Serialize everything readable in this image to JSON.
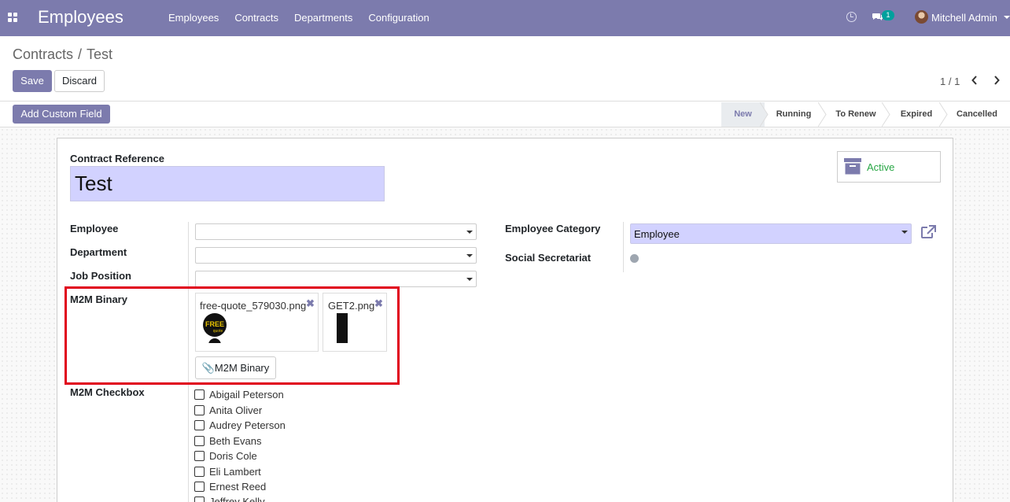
{
  "navbar": {
    "app_title": "Employees",
    "menu": [
      "Employees",
      "Contracts",
      "Departments",
      "Configuration"
    ],
    "messages_count": "1",
    "user_name": "Mitchell Admin",
    "color": "#7c7bad"
  },
  "breadcrumb": {
    "parent": "Contracts",
    "separator": "/",
    "current": "Test"
  },
  "buttons": {
    "save": "Save",
    "discard": "Discard",
    "add_custom_field": "Add Custom Field"
  },
  "pager": {
    "text": "1 / 1"
  },
  "stages": [
    {
      "label": "New",
      "current": true
    },
    {
      "label": "Running",
      "current": false
    },
    {
      "label": "To Renew",
      "current": false
    },
    {
      "label": "Expired",
      "current": false
    },
    {
      "label": "Cancelled",
      "current": false
    }
  ],
  "form": {
    "contract_reference_label": "Contract Reference",
    "contract_reference_value": "Test",
    "active_label": "Active",
    "employee_label": "Employee",
    "employee_value": "",
    "department_label": "Department",
    "department_value": "",
    "job_position_label": "Job Position",
    "job_position_value": "",
    "employee_category_label": "Employee Category",
    "employee_category_value": "Employee",
    "social_secretariat_label": "Social Secretariat",
    "m2m_binary_label": "M2M Binary",
    "m2m_binary_files": [
      "free-quote_579030.png",
      "GET2.png"
    ],
    "m2m_binary_button": "M2M Binary",
    "m2m_checkbox_label": "M2M Checkbox",
    "m2m_checkbox_items": [
      "Abigail Peterson",
      "Anita Oliver",
      "Audrey Peterson",
      "Beth Evans",
      "Doris Cole",
      "Eli Lambert",
      "Ernest Reed",
      "Jeffrey Kelly"
    ]
  },
  "thumbnails": {
    "free_quote_text_1": "FREE",
    "free_quote_text_2": "quote"
  },
  "colors": {
    "accent": "#7c7bad",
    "active_green": "#28a745",
    "highlight_red": "#e0001b",
    "input_bg": "#d2d2ff",
    "badge": "#00a09d"
  },
  "icons": [
    "apps-grid-icon",
    "clock-icon",
    "chat-icon",
    "avatar",
    "chevron-left-icon",
    "chevron-right-icon",
    "archive-icon",
    "external-link-icon",
    "remove-icon",
    "paperclip-icon"
  ]
}
